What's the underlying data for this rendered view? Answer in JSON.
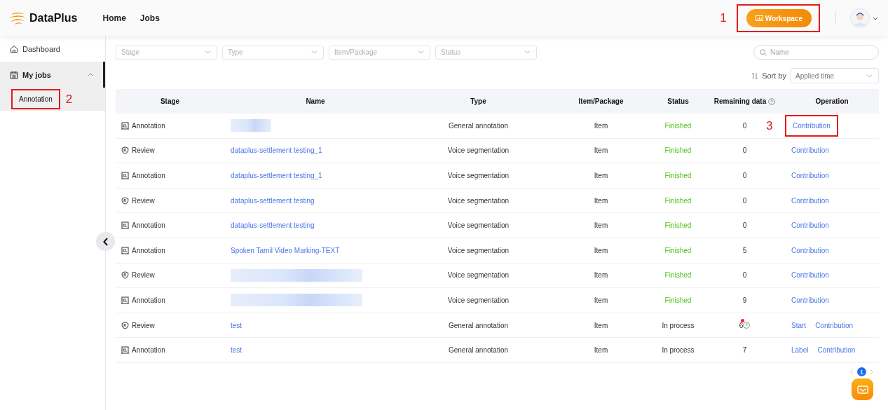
{
  "header": {
    "brand": "DataPlus",
    "nav": [
      "Home",
      "Jobs"
    ],
    "workspace": {
      "label": "Workspace",
      "callout": "1"
    }
  },
  "sidebar": {
    "items": [
      {
        "kind": "link",
        "label": "Dashboard",
        "selected": false
      },
      {
        "kind": "group",
        "label": "My jobs",
        "expanded": true,
        "children": [
          {
            "label": "Annotation",
            "selected": true,
            "callout": "2"
          }
        ]
      }
    ]
  },
  "filters": [
    {
      "placeholder": "Stage"
    },
    {
      "placeholder": "Type"
    },
    {
      "placeholder": "Item/Package"
    },
    {
      "placeholder": "Status"
    }
  ],
  "search": {
    "placeholder": "Name"
  },
  "sort": {
    "label": "Sort by",
    "value": "Applied time"
  },
  "table": {
    "columns": [
      "Stage",
      "Name",
      "Type",
      "Item/Package",
      "Status",
      "Remaining data",
      "Operation"
    ],
    "rows": [
      {
        "stage": {
          "kind": "annotation",
          "label": "Annotation"
        },
        "name": {
          "kind": "redacted"
        },
        "type": "General annotation",
        "item": "Item",
        "status": {
          "kind": "finished",
          "label": "Finished"
        },
        "remaining": {
          "value": "0",
          "alert": false
        },
        "operations": [
          {
            "label": "Contribution",
            "callout": "3"
          }
        ]
      },
      {
        "stage": {
          "kind": "review",
          "label": "Review"
        },
        "name": {
          "kind": "link",
          "text": "dataplus-settlement testing_1"
        },
        "type": "Voice segmentation",
        "item": "Item",
        "status": {
          "kind": "finished",
          "label": "Finished"
        },
        "remaining": {
          "value": "0",
          "alert": false
        },
        "operations": [
          {
            "label": "Contribution"
          }
        ]
      },
      {
        "stage": {
          "kind": "annotation",
          "label": "Annotation"
        },
        "name": {
          "kind": "link",
          "text": "dataplus-settlement testing_1"
        },
        "type": "Voice segmentation",
        "item": "Item",
        "status": {
          "kind": "finished",
          "label": "Finished"
        },
        "remaining": {
          "value": "0",
          "alert": false
        },
        "operations": [
          {
            "label": "Contribution"
          }
        ]
      },
      {
        "stage": {
          "kind": "review",
          "label": "Review"
        },
        "name": {
          "kind": "link",
          "text": "dataplus-settlement testing"
        },
        "type": "Voice segmentation",
        "item": "Item",
        "status": {
          "kind": "finished",
          "label": "Finished"
        },
        "remaining": {
          "value": "0",
          "alert": false
        },
        "operations": [
          {
            "label": "Contribution"
          }
        ]
      },
      {
        "stage": {
          "kind": "annotation",
          "label": "Annotation"
        },
        "name": {
          "kind": "link",
          "text": "dataplus-settlement testing"
        },
        "type": "Voice segmentation",
        "item": "Item",
        "status": {
          "kind": "finished",
          "label": "Finished"
        },
        "remaining": {
          "value": "0",
          "alert": false
        },
        "operations": [
          {
            "label": "Contribution"
          }
        ]
      },
      {
        "stage": {
          "kind": "annotation",
          "label": "Annotation"
        },
        "name": {
          "kind": "link",
          "text": "Spoken Tamil Video Marking-TEXT"
        },
        "type": "Voice segmentation",
        "item": "Item",
        "status": {
          "kind": "finished",
          "label": "Finished"
        },
        "remaining": {
          "value": "5",
          "alert": false
        },
        "operations": [
          {
            "label": "Contribution"
          }
        ]
      },
      {
        "stage": {
          "kind": "review",
          "label": "Review"
        },
        "name": {
          "kind": "redacted_wide"
        },
        "type": "Voice segmentation",
        "item": "Item",
        "status": {
          "kind": "finished",
          "label": "Finished"
        },
        "remaining": {
          "value": "0",
          "alert": false
        },
        "operations": [
          {
            "label": "Contribution"
          }
        ]
      },
      {
        "stage": {
          "kind": "annotation",
          "label": "Annotation"
        },
        "name": {
          "kind": "redacted_wide"
        },
        "type": "Voice segmentation",
        "item": "Item",
        "status": {
          "kind": "finished",
          "label": "Finished"
        },
        "remaining": {
          "value": "9",
          "alert": false
        },
        "operations": [
          {
            "label": "Contribution"
          }
        ]
      },
      {
        "stage": {
          "kind": "review",
          "label": "Review"
        },
        "name": {
          "kind": "link",
          "text": "test"
        },
        "type": "General annotation",
        "item": "Item",
        "status": {
          "kind": "in_process",
          "label": "In process"
        },
        "remaining": {
          "value": "6",
          "alert": true
        },
        "operations": [
          {
            "label": "Start"
          },
          {
            "label": "Contribution"
          }
        ]
      },
      {
        "stage": {
          "kind": "annotation",
          "label": "Annotation"
        },
        "name": {
          "kind": "link",
          "text": "test"
        },
        "type": "General annotation",
        "item": "Item",
        "status": {
          "kind": "in_process",
          "label": "In process"
        },
        "remaining": {
          "value": "7",
          "alert": false
        },
        "operations": [
          {
            "label": "Label"
          },
          {
            "label": "Contribution"
          }
        ]
      }
    ]
  },
  "pagination": {
    "current": "1"
  }
}
